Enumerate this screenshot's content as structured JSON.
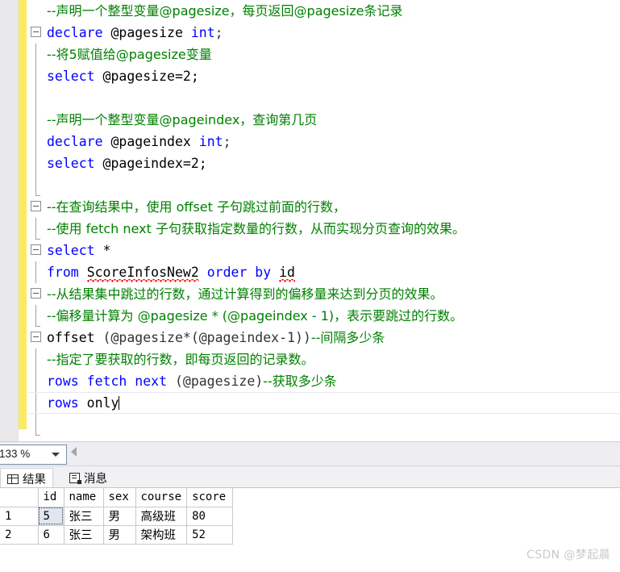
{
  "editor": {
    "zoom_level": "133 %",
    "lines": [
      {
        "id": "l1",
        "fold": "none",
        "guide": "none",
        "tokens": [
          {
            "t": "--声明一个整型变量@pagesize，每页返回@pagesize条记录",
            "c": "cmt cn"
          }
        ]
      },
      {
        "id": "l2",
        "fold": "minus",
        "guide": "none",
        "tokens": [
          {
            "t": "declare",
            "c": "kw"
          },
          {
            "t": " @pagesize ",
            "c": "plain"
          },
          {
            "t": "int",
            "c": "kw"
          },
          {
            "t": ";",
            "c": "gray"
          }
        ]
      },
      {
        "id": "l3",
        "fold": "none",
        "guide": "line",
        "tokens": [
          {
            "t": "--将5赋值给@pagesize变量",
            "c": "cmt cn"
          }
        ]
      },
      {
        "id": "l4",
        "fold": "none",
        "guide": "line",
        "tokens": [
          {
            "t": "select",
            "c": "kw"
          },
          {
            "t": " @pagesize=2;",
            "c": "plain"
          }
        ]
      },
      {
        "id": "l5",
        "fold": "none",
        "guide": "line",
        "tokens": []
      },
      {
        "id": "l6",
        "fold": "none",
        "guide": "line",
        "tokens": [
          {
            "t": "--声明一个整型变量@pageindex，查询第几页",
            "c": "cmt cn"
          }
        ]
      },
      {
        "id": "l7",
        "fold": "none",
        "guide": "line",
        "tokens": [
          {
            "t": "declare",
            "c": "kw"
          },
          {
            "t": " @pageindex ",
            "c": "plain"
          },
          {
            "t": "int",
            "c": "kw"
          },
          {
            "t": ";",
            "c": "gray"
          }
        ]
      },
      {
        "id": "l8",
        "fold": "none",
        "guide": "line",
        "tokens": [
          {
            "t": "select",
            "c": "kw"
          },
          {
            "t": " @pageindex=2;",
            "c": "plain"
          }
        ]
      },
      {
        "id": "l9",
        "fold": "none",
        "guide": "foot",
        "tokens": []
      },
      {
        "id": "l10",
        "fold": "minus",
        "guide": "none",
        "tokens": [
          {
            "t": "--在查询结果中，使用 offset 子句跳过前面的行数，",
            "c": "cmt cn"
          }
        ]
      },
      {
        "id": "l11",
        "fold": "none",
        "guide": "foot",
        "tokens": [
          {
            "t": "--使用 fetch next 子句获取指定数量的行数，从而实现分页查询的效果。",
            "c": "cmt cn"
          }
        ]
      },
      {
        "id": "l12",
        "fold": "minus",
        "guide": "none",
        "tokens": [
          {
            "t": "select",
            "c": "kw"
          },
          {
            "t": " *",
            "c": "plain"
          }
        ]
      },
      {
        "id": "l13",
        "fold": "none",
        "guide": "line",
        "tokens": [
          {
            "t": "from",
            "c": "kw"
          },
          {
            "t": " ",
            "c": "plain"
          },
          {
            "t": "ScoreInfosNew2",
            "c": "err"
          },
          {
            "t": " ",
            "c": "plain"
          },
          {
            "t": "order by",
            "c": "kw"
          },
          {
            "t": " ",
            "c": "plain"
          },
          {
            "t": "id",
            "c": "err"
          }
        ]
      },
      {
        "id": "l14",
        "fold": "minus",
        "guide": "none",
        "tokens": [
          {
            "t": "--从结果集中跳过的行数，通过计算得到的偏移量来达到分页的效果。",
            "c": "cmt cn"
          }
        ]
      },
      {
        "id": "l15",
        "fold": "none",
        "guide": "foot",
        "tokens": [
          {
            "t": "--偏移量计算为 @pagesize * (@pageindex - 1)，表示要跳过的行数。",
            "c": "cmt cn"
          }
        ]
      },
      {
        "id": "l16",
        "fold": "minus",
        "guide": "none",
        "tokens": [
          {
            "t": "offset",
            "c": "plain"
          },
          {
            "t": " (@pagesize*(@pageindex-1))",
            "c": "gray"
          },
          {
            "t": "--间隔多少条",
            "c": "cmt cn"
          }
        ]
      },
      {
        "id": "l17",
        "fold": "none",
        "guide": "line",
        "tokens": [
          {
            "t": "--指定了要获取的行数，即每页返回的记录数。",
            "c": "cmt cn"
          }
        ]
      },
      {
        "id": "l18",
        "fold": "none",
        "guide": "line",
        "tokens": [
          {
            "t": "rows fetch next",
            "c": "kw"
          },
          {
            "t": " (@pagesize)",
            "c": "gray"
          },
          {
            "t": "--获取多少条",
            "c": "cmt cn"
          }
        ]
      },
      {
        "id": "l19",
        "fold": "none",
        "guide": "line",
        "current": true,
        "tokens": [
          {
            "t": "rows",
            "c": "kw"
          },
          {
            "t": " only",
            "c": "plain"
          }
        ],
        "caret": true
      },
      {
        "id": "l20",
        "fold": "none",
        "guide": "foot",
        "tokens": []
      }
    ]
  },
  "results_panel": {
    "tabs": [
      {
        "key": "results",
        "label": "结果",
        "icon": "grid-icon",
        "active": true
      },
      {
        "key": "messages",
        "label": "消息",
        "icon": "message-icon",
        "active": false
      }
    ],
    "grid": {
      "row_header_label": "",
      "columns": [
        "id",
        "name",
        "sex",
        "course",
        "score"
      ],
      "rows": [
        {
          "num": "1",
          "cells": [
            "5",
            "张三",
            "男",
            "高级班",
            "80"
          ]
        },
        {
          "num": "2",
          "cells": [
            "6",
            "张三",
            "男",
            "架构班",
            "52"
          ]
        }
      ],
      "selected_cell": {
        "row": 0,
        "col": 0
      }
    }
  },
  "watermark": {
    "text": "CSDN @梦起晨"
  },
  "colors": {
    "keyword": "#0000ff",
    "comment": "#008000",
    "error_squiggle": "#ff0000",
    "change_bar": "#fbea62",
    "selection": "#dfe6ef"
  }
}
